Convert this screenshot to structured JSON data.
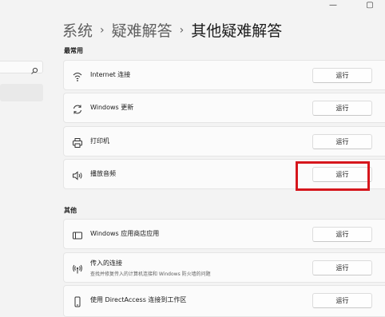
{
  "window": {
    "minimize": "—",
    "maximize": "▢"
  },
  "breadcrumb": {
    "item1": "系统",
    "item2": "疑难解答",
    "current": "其他疑难解答",
    "sep": "›"
  },
  "sections": {
    "frequent": "最常用",
    "other": "其他"
  },
  "run_label": "运行",
  "items": [
    {
      "label": "Internet 连接",
      "icon": "wifi-icon"
    },
    {
      "label": "Windows 更新",
      "icon": "sync-icon"
    },
    {
      "label": "打印机",
      "icon": "printer-icon"
    },
    {
      "label": "播放音频",
      "icon": "speaker-icon"
    },
    {
      "label": "Windows 应用商店应用",
      "icon": "store-app-icon"
    },
    {
      "label": "传入的连接",
      "description": "查找并修复传入的计算机连接和 Windows 防火墙的问题",
      "icon": "incoming-connection-icon"
    },
    {
      "label": "使用 DirectAccess 连接到工作区",
      "icon": "phone-device-icon"
    }
  ],
  "colors": {
    "highlight": "#d6161c",
    "card": "#fbfbfb",
    "background": "#f3f3f3"
  }
}
